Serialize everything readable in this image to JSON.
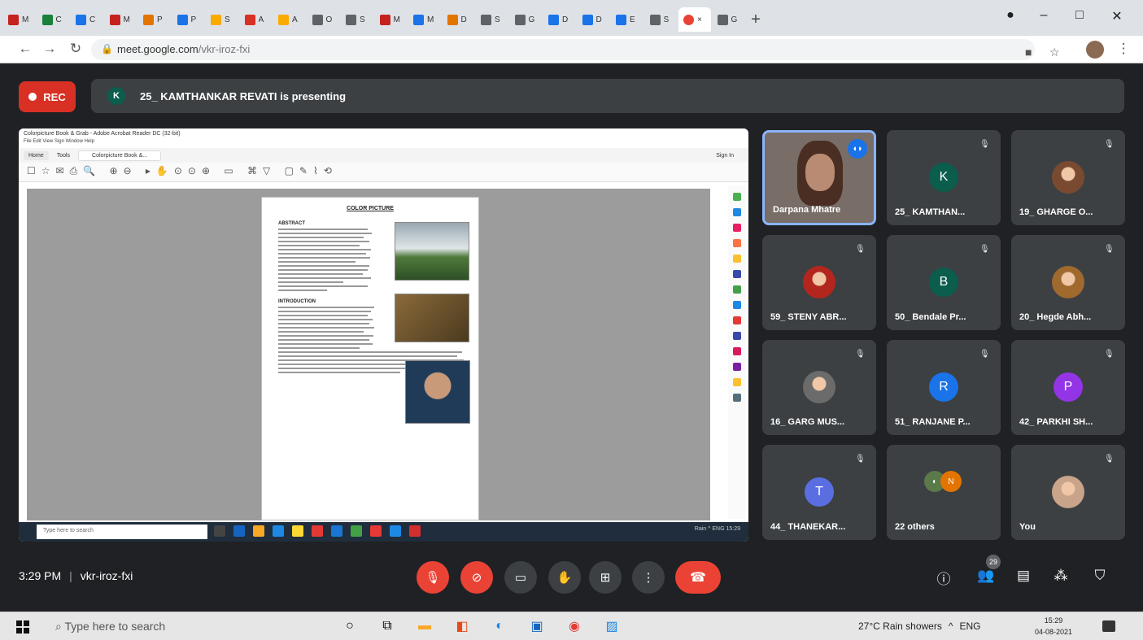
{
  "browser": {
    "tabs": [
      {
        "label": "M",
        "color": "#c5221f"
      },
      {
        "label": "C",
        "color": "#188038"
      },
      {
        "label": "C",
        "color": "#1a73e8"
      },
      {
        "label": "M",
        "color": "#c5221f"
      },
      {
        "label": "P",
        "color": "#e37400"
      },
      {
        "label": "P",
        "color": "#1a73e8"
      },
      {
        "label": "S",
        "color": "#f9ab00"
      },
      {
        "label": "A",
        "color": "#d93025"
      },
      {
        "label": "A",
        "color": "#f9ab00"
      },
      {
        "label": "O",
        "color": "#5f6368"
      },
      {
        "label": "S",
        "color": "#5f6368"
      },
      {
        "label": "M",
        "color": "#c5221f"
      },
      {
        "label": "M",
        "color": "#1a73e8"
      },
      {
        "label": "D",
        "color": "#e37400"
      },
      {
        "label": "S",
        "color": "#5f6368"
      },
      {
        "label": "G",
        "color": "#5f6368"
      },
      {
        "label": "D",
        "color": "#1a73e8"
      },
      {
        "label": "D",
        "color": "#1a73e8"
      },
      {
        "label": "E",
        "color": "#1a73e8"
      },
      {
        "label": "S",
        "color": "#5f6368"
      }
    ],
    "active_tab_close": "×",
    "last_tab_label": "G",
    "url_domain": "meet.google.com",
    "url_path": "/vkr-iroz-fxi"
  },
  "meet": {
    "rec_label": "REC",
    "presenter_initial": "K",
    "presenting_text": "25_ KAMTHANKAR REVATI is presenting",
    "time": "3:29 PM",
    "meeting_code": "vkr-iroz-fxi",
    "participants_count": "29",
    "tiles": [
      {
        "name": "Darpana Mhatre",
        "type": "video"
      },
      {
        "name": "25_ KAMTHAN...",
        "initial": "K",
        "color": "#0b5d4c"
      },
      {
        "name": "19_ GHARGE O...",
        "type": "photo",
        "color": "#7a4a30"
      },
      {
        "name": "59_ STENY ABR...",
        "type": "photo",
        "color": "#b3261e"
      },
      {
        "name": "50_ Bendale Pr...",
        "initial": "B",
        "color": "#0b5d4c"
      },
      {
        "name": "20_ Hegde Abh...",
        "type": "photo",
        "color": "#a0692e"
      },
      {
        "name": "16_ GARG MUS...",
        "type": "photo",
        "color": "#6b6b6b"
      },
      {
        "name": "51_ RANJANE P...",
        "initial": "R",
        "color": "#1a73e8"
      },
      {
        "name": "42_ PARKHI SH...",
        "initial": "P",
        "color": "#9334e6"
      },
      {
        "name": "44_ THANEKAR...",
        "initial": "T",
        "color": "#5b6ee1"
      },
      {
        "name": "22 others",
        "type": "others"
      },
      {
        "name": "You",
        "type": "photo",
        "color": "#c9a38a"
      }
    ]
  },
  "shared": {
    "window_title": "Colorpicture Book & Grab - Adobe Acrobat Reader DC (32-bit)",
    "menu": "File  Edit  View  Sign  Window  Help",
    "home_tab": "Home",
    "tools_tab": "Tools",
    "doc_tab": "Colorpicture Book &...",
    "sign_in": "Sign In",
    "page_title": "COLOR PICTURE",
    "abstract_heading": "ABSTRACT",
    "intro_heading": "INTRODUCTION",
    "search_text": "Type here to search",
    "tray_text": "Rain  ^ ENG  15:29"
  },
  "taskbar": {
    "search_placeholder": "Type here to search",
    "weather": "27°C  Rain showers",
    "lang": "ENG",
    "time": "15:29",
    "date": "04-08-2021"
  }
}
